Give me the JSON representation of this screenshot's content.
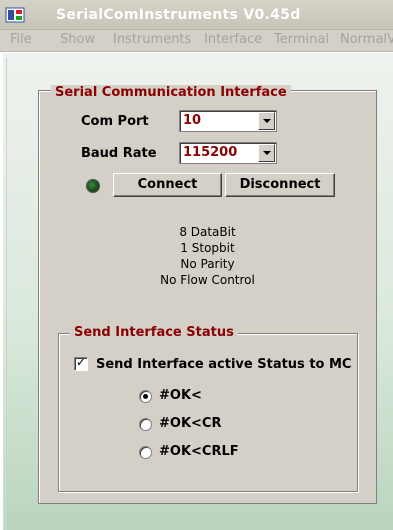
{
  "window": {
    "title": "SerialComInstruments  V0.45d",
    "icon": "app-instrument-icon"
  },
  "menu": [
    "File",
    "Show",
    "Instruments",
    "Interface",
    "Terminal",
    "NormalV"
  ],
  "serial_group": {
    "title": "Serial Communication Interface",
    "com_port_label": "Com Port",
    "com_port_value": "10",
    "baud_rate_label": "Baud Rate",
    "baud_rate_value": "115200",
    "connect_label": "Connect",
    "disconnect_label": "Disconnect",
    "status_led_color": "#1f5a1f",
    "info_lines": [
      "8 DataBit",
      "1 Stopbit",
      "No Parity",
      "No Flow Control"
    ]
  },
  "status_group": {
    "title": "Send Interface Status",
    "checkbox_label": "Send Interface active Status to MC",
    "checkbox_checked": true,
    "radio_options": [
      "#OK<",
      "#OK<CR",
      "#OK<CRLF"
    ],
    "radio_selected_index": 0
  },
  "colors": {
    "accent_red": "#8b0000",
    "face": "#d4d0c8"
  }
}
